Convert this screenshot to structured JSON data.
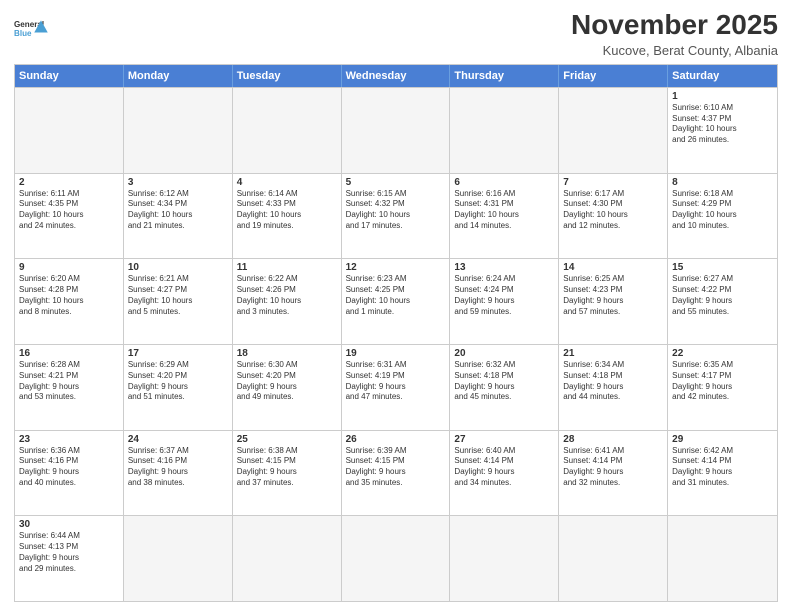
{
  "logo": {
    "text_general": "General",
    "text_blue": "Blue"
  },
  "title": "November 2025",
  "subtitle": "Kucove, Berat County, Albania",
  "header_days": [
    "Sunday",
    "Monday",
    "Tuesday",
    "Wednesday",
    "Thursday",
    "Friday",
    "Saturday"
  ],
  "weeks": [
    [
      {
        "day": "",
        "empty": true,
        "text": ""
      },
      {
        "day": "",
        "empty": true,
        "text": ""
      },
      {
        "day": "",
        "empty": true,
        "text": ""
      },
      {
        "day": "",
        "empty": true,
        "text": ""
      },
      {
        "day": "",
        "empty": true,
        "text": ""
      },
      {
        "day": "",
        "empty": true,
        "text": ""
      },
      {
        "day": "1",
        "text": "Sunrise: 6:10 AM\nSunset: 4:37 PM\nDaylight: 10 hours\nand 26 minutes."
      }
    ],
    [
      {
        "day": "2",
        "text": "Sunrise: 6:11 AM\nSunset: 4:35 PM\nDaylight: 10 hours\nand 24 minutes."
      },
      {
        "day": "3",
        "text": "Sunrise: 6:12 AM\nSunset: 4:34 PM\nDaylight: 10 hours\nand 21 minutes."
      },
      {
        "day": "4",
        "text": "Sunrise: 6:14 AM\nSunset: 4:33 PM\nDaylight: 10 hours\nand 19 minutes."
      },
      {
        "day": "5",
        "text": "Sunrise: 6:15 AM\nSunset: 4:32 PM\nDaylight: 10 hours\nand 17 minutes."
      },
      {
        "day": "6",
        "text": "Sunrise: 6:16 AM\nSunset: 4:31 PM\nDaylight: 10 hours\nand 14 minutes."
      },
      {
        "day": "7",
        "text": "Sunrise: 6:17 AM\nSunset: 4:30 PM\nDaylight: 10 hours\nand 12 minutes."
      },
      {
        "day": "8",
        "text": "Sunrise: 6:18 AM\nSunset: 4:29 PM\nDaylight: 10 hours\nand 10 minutes."
      }
    ],
    [
      {
        "day": "9",
        "text": "Sunrise: 6:20 AM\nSunset: 4:28 PM\nDaylight: 10 hours\nand 8 minutes."
      },
      {
        "day": "10",
        "text": "Sunrise: 6:21 AM\nSunset: 4:27 PM\nDaylight: 10 hours\nand 5 minutes."
      },
      {
        "day": "11",
        "text": "Sunrise: 6:22 AM\nSunset: 4:26 PM\nDaylight: 10 hours\nand 3 minutes."
      },
      {
        "day": "12",
        "text": "Sunrise: 6:23 AM\nSunset: 4:25 PM\nDaylight: 10 hours\nand 1 minute."
      },
      {
        "day": "13",
        "text": "Sunrise: 6:24 AM\nSunset: 4:24 PM\nDaylight: 9 hours\nand 59 minutes."
      },
      {
        "day": "14",
        "text": "Sunrise: 6:25 AM\nSunset: 4:23 PM\nDaylight: 9 hours\nand 57 minutes."
      },
      {
        "day": "15",
        "text": "Sunrise: 6:27 AM\nSunset: 4:22 PM\nDaylight: 9 hours\nand 55 minutes."
      }
    ],
    [
      {
        "day": "16",
        "text": "Sunrise: 6:28 AM\nSunset: 4:21 PM\nDaylight: 9 hours\nand 53 minutes."
      },
      {
        "day": "17",
        "text": "Sunrise: 6:29 AM\nSunset: 4:20 PM\nDaylight: 9 hours\nand 51 minutes."
      },
      {
        "day": "18",
        "text": "Sunrise: 6:30 AM\nSunset: 4:20 PM\nDaylight: 9 hours\nand 49 minutes."
      },
      {
        "day": "19",
        "text": "Sunrise: 6:31 AM\nSunset: 4:19 PM\nDaylight: 9 hours\nand 47 minutes."
      },
      {
        "day": "20",
        "text": "Sunrise: 6:32 AM\nSunset: 4:18 PM\nDaylight: 9 hours\nand 45 minutes."
      },
      {
        "day": "21",
        "text": "Sunrise: 6:34 AM\nSunset: 4:18 PM\nDaylight: 9 hours\nand 44 minutes."
      },
      {
        "day": "22",
        "text": "Sunrise: 6:35 AM\nSunset: 4:17 PM\nDaylight: 9 hours\nand 42 minutes."
      }
    ],
    [
      {
        "day": "23",
        "text": "Sunrise: 6:36 AM\nSunset: 4:16 PM\nDaylight: 9 hours\nand 40 minutes."
      },
      {
        "day": "24",
        "text": "Sunrise: 6:37 AM\nSunset: 4:16 PM\nDaylight: 9 hours\nand 38 minutes."
      },
      {
        "day": "25",
        "text": "Sunrise: 6:38 AM\nSunset: 4:15 PM\nDaylight: 9 hours\nand 37 minutes."
      },
      {
        "day": "26",
        "text": "Sunrise: 6:39 AM\nSunset: 4:15 PM\nDaylight: 9 hours\nand 35 minutes."
      },
      {
        "day": "27",
        "text": "Sunrise: 6:40 AM\nSunset: 4:14 PM\nDaylight: 9 hours\nand 34 minutes."
      },
      {
        "day": "28",
        "text": "Sunrise: 6:41 AM\nSunset: 4:14 PM\nDaylight: 9 hours\nand 32 minutes."
      },
      {
        "day": "29",
        "text": "Sunrise: 6:42 AM\nSunset: 4:14 PM\nDaylight: 9 hours\nand 31 minutes."
      }
    ],
    [
      {
        "day": "30",
        "text": "Sunrise: 6:44 AM\nSunset: 4:13 PM\nDaylight: 9 hours\nand 29 minutes."
      },
      {
        "day": "",
        "empty": true,
        "text": ""
      },
      {
        "day": "",
        "empty": true,
        "text": ""
      },
      {
        "day": "",
        "empty": true,
        "text": ""
      },
      {
        "day": "",
        "empty": true,
        "text": ""
      },
      {
        "day": "",
        "empty": true,
        "text": ""
      },
      {
        "day": "",
        "empty": true,
        "text": ""
      }
    ]
  ]
}
